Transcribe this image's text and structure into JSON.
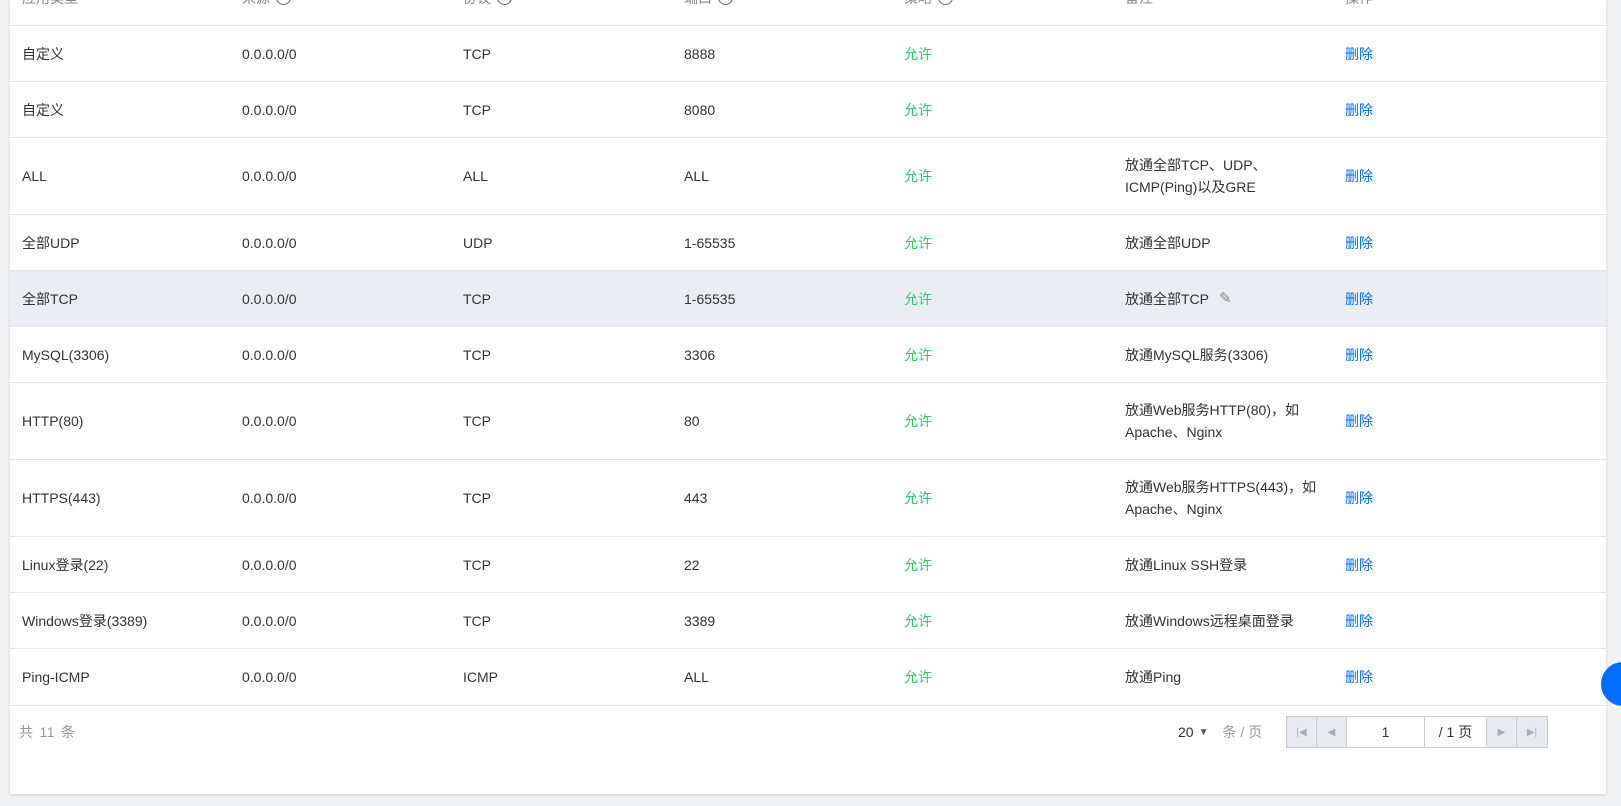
{
  "columns": [
    {
      "label": "应用类型",
      "info": false
    },
    {
      "label": "来源",
      "info": true
    },
    {
      "label": "协议",
      "info": true
    },
    {
      "label": "端口",
      "info": true
    },
    {
      "label": "策略",
      "info": true
    },
    {
      "label": "备注",
      "info": false
    },
    {
      "label": "操作",
      "info": false
    }
  ],
  "rows": [
    {
      "type": "自定义",
      "source": "0.0.0.0/0",
      "protocol": "TCP",
      "port": "8888",
      "policy": "允许",
      "note": "",
      "action": "删除"
    },
    {
      "type": "自定义",
      "source": "0.0.0.0/0",
      "protocol": "TCP",
      "port": "8080",
      "policy": "允许",
      "note": "",
      "action": "删除"
    },
    {
      "type": "ALL",
      "source": "0.0.0.0/0",
      "protocol": "ALL",
      "port": "ALL",
      "policy": "允许",
      "note": "放通全部TCP、UDP、ICMP(Ping)以及GRE",
      "action": "删除"
    },
    {
      "type": "全部UDP",
      "source": "0.0.0.0/0",
      "protocol": "UDP",
      "port": "1-65535",
      "policy": "允许",
      "note": "放通全部UDP",
      "action": "删除"
    },
    {
      "type": "全部TCP",
      "source": "0.0.0.0/0",
      "protocol": "TCP",
      "port": "1-65535",
      "policy": "允许",
      "note": "放通全部TCP",
      "action": "删除",
      "hover": true
    },
    {
      "type": "MySQL(3306)",
      "source": "0.0.0.0/0",
      "protocol": "TCP",
      "port": "3306",
      "policy": "允许",
      "note": "放通MySQL服务(3306)",
      "action": "删除"
    },
    {
      "type": "HTTP(80)",
      "source": "0.0.0.0/0",
      "protocol": "TCP",
      "port": "80",
      "policy": "允许",
      "note": "放通Web服务HTTP(80)，如 Apache、Nginx",
      "action": "删除"
    },
    {
      "type": "HTTPS(443)",
      "source": "0.0.0.0/0",
      "protocol": "TCP",
      "port": "443",
      "policy": "允许",
      "note": "放通Web服务HTTPS(443)，如 Apache、Nginx",
      "action": "删除"
    },
    {
      "type": "Linux登录(22)",
      "source": "0.0.0.0/0",
      "protocol": "TCP",
      "port": "22",
      "policy": "允许",
      "note": "放通Linux SSH登录",
      "action": "删除"
    },
    {
      "type": "Windows登录(3389)",
      "source": "0.0.0.0/0",
      "protocol": "TCP",
      "port": "3389",
      "policy": "允许",
      "note": "放通Windows远程桌面登录",
      "action": "删除"
    },
    {
      "type": "Ping-ICMP",
      "source": "0.0.0.0/0",
      "protocol": "ICMP",
      "port": "ALL",
      "policy": "允许",
      "note": "放通Ping",
      "action": "删除"
    }
  ],
  "footer": {
    "total_prefix": "共",
    "total_count": "11",
    "total_suffix": "条",
    "page_size": "20",
    "page_size_unit": "条 / 页",
    "current_page": "1",
    "total_pages": "/ 1 页"
  },
  "colors": {
    "allow": "#29cc6a",
    "link": "#006eff",
    "hover_row": "#eaedf2"
  }
}
